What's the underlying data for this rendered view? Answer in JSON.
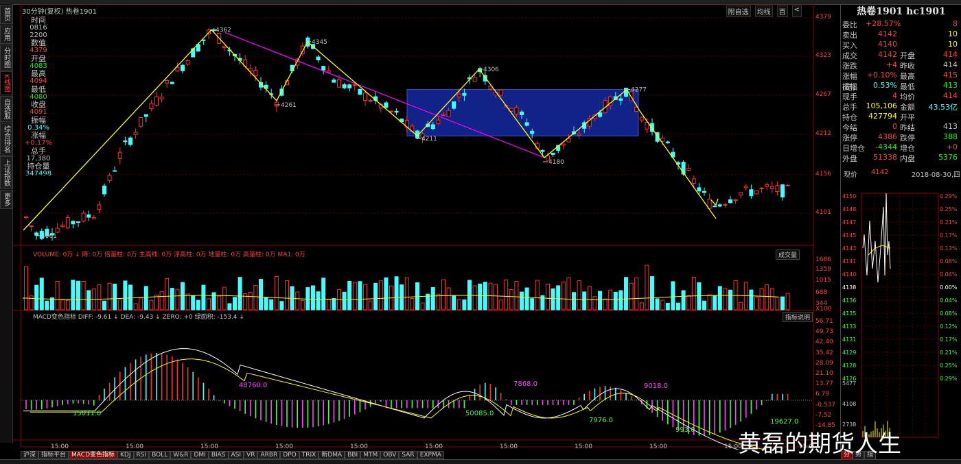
{
  "panel_title": "30分钟(复权)  热卷1901",
  "top_tools": [
    "附自选",
    "均线",
    "百",
    "<"
  ],
  "left_tabs": [
    "首页",
    "应用",
    "分时图",
    "K线图",
    "自选股",
    "综合排名",
    "上证指数",
    "更多"
  ],
  "info": [
    {
      "label": "时间",
      "value": "0816"
    },
    {
      "label": "",
      "value": "2200"
    },
    {
      "label": "数值",
      "value": "4379"
    },
    {
      "label": "开盘",
      "value": "4083"
    },
    {
      "label": "最高",
      "value": "4094"
    },
    {
      "label": "最低",
      "value": "4080"
    },
    {
      "label": "收盘",
      "value": "4091"
    },
    {
      "label": "振幅",
      "value": "0.34%"
    },
    {
      "label": "涨幅",
      "value": "+0.17%"
    },
    {
      "label": "总手",
      "value": "17,380"
    },
    {
      "label": "持仓量",
      "value": "347498"
    }
  ],
  "price_axis": [
    "4379",
    "4323",
    "4267",
    "4212",
    "4156",
    "4101"
  ],
  "price_annotations": [
    "4362",
    "4345",
    "4261",
    "4306",
    "4277",
    "4211",
    "4180",
    "4061"
  ],
  "volume_bar_text": "VOLUME: 0万 ↓  降: 0万  倍量柱: 0万  主高线: 0万  浮高柱: 0万  地量柱: 0万  高量柱: 0万  MA1: 0万",
  "volume_tag": "成交量",
  "volume_axis": [
    "1686",
    "1359",
    "1015",
    "688",
    "344",
    "X100"
  ],
  "macd_bar_text": "MACD变色指标  DIFF: -9.61 ↓  DEA: -9.43 ↓  ZERO: +0  绿面积: -153.4 ↓",
  "macd_tag": "指标说明",
  "macd_axis": [
    "56.71",
    "49.73",
    "42.40",
    "35.42",
    "28.09",
    "21.10",
    "13.77",
    "6.79",
    "-0.537",
    "-7.52",
    "-14.85"
  ],
  "macd_annotations": [
    "48760.0",
    "7868.0",
    "9018.0",
    "15011.0",
    "50085.0",
    "7976.0",
    "993.0",
    "19627.0"
  ],
  "time_labels": [
    "15:00",
    "15:00",
    "15:00",
    "15:00",
    "15:00",
    "15:00",
    "15:00",
    "15:00",
    "15:00",
    "15:00",
    "15:00"
  ],
  "bottom_tabs": [
    "沪深",
    "指标平台",
    "MACD变色指标",
    "KDJ",
    "RSI",
    "BOLL",
    "W&R",
    "DMI",
    "BIAS",
    "ASI",
    "VR",
    "ARBR",
    "DPO",
    "TRIX",
    "新DMA",
    "BBI",
    "MTM",
    "OBV",
    "SAR",
    "EXPMA"
  ],
  "right": {
    "title": "热卷1901  hc1901",
    "rows": [
      {
        "k": "委比",
        "v": "+28.57%",
        "c": "#ff4040",
        "k2": "",
        "v2": "8",
        "c2": "#ff4040"
      },
      {
        "k": "卖出",
        "v": "4142",
        "c": "#ff4040",
        "k2": "",
        "v2": "10",
        "c2": "#ffff00"
      },
      {
        "k": "买入",
        "v": "4140",
        "c": "#ff4040",
        "k2": "",
        "v2": "10",
        "c2": "#ffff00"
      },
      {
        "k": "成交",
        "v": "4142",
        "c": "#ff4040",
        "k2": "开盘",
        "v2": "414",
        "c2": "#ff4040"
      },
      {
        "k": "涨跌",
        "v": "+4",
        "c": "#ff4040",
        "k2": "昨收",
        "v2": "414",
        "c2": "#c0c0c0"
      },
      {
        "k": "涨幅(结)",
        "v": "+0.10%",
        "c": "#ff4040",
        "k2": "最高",
        "v2": "415",
        "c2": "#ff4040"
      },
      {
        "k": "振幅",
        "v": "0.53%",
        "c": "#40ffff",
        "k2": "最低",
        "v2": "413",
        "c2": "#00ff00"
      },
      {
        "k": "现手",
        "v": "4",
        "c": "#ff4040",
        "k2": "均价",
        "v2": "414",
        "c2": "#ff4040"
      },
      {
        "k": "总手",
        "v": "105,106",
        "c": "#ffff00",
        "k2": "金额",
        "v2": "43.53亿",
        "c2": "#40ffff"
      },
      {
        "k": "持仓",
        "v": "427794",
        "c": "#ffff00",
        "k2": "开平",
        "v2": "",
        "c2": "#c0c0c0"
      },
      {
        "k": "今结",
        "v": "0",
        "c": "#ff4040",
        "k2": "昨结",
        "v2": "413",
        "c2": "#c0c0c0"
      },
      {
        "k": "涨停",
        "v": "4386",
        "c": "#ff4040",
        "k2": "跌停",
        "v2": "388",
        "c2": "#00ff00"
      },
      {
        "k": "日增仓",
        "v": "-4344",
        "c": "#00ff00",
        "k2": "增仓",
        "v2": "+0",
        "c2": "#ff4040"
      },
      {
        "k": "外盘",
        "v": "51338",
        "c": "#ff4040",
        "k2": "内盘",
        "v2": "5376",
        "c2": "#00ff00"
      }
    ],
    "now_label": "现价",
    "now_value": "4142",
    "date": "2018-08-30,四",
    "mini_left_axis": [
      "4150",
      "4148",
      "4147",
      "4145",
      "4143",
      "4141",
      "4140",
      "4138",
      "4136",
      "4135",
      "4133",
      "4131",
      "4129",
      "4128",
      "4126",
      "5477",
      "4108",
      "2738"
    ],
    "mini_right_axis": [
      "0.29%",
      "0.25%",
      "0.21%",
      "0.17%",
      "0.13%",
      "0.08%",
      "0.04%",
      "0.00%",
      "0.04%",
      "0.08%",
      "0.12%",
      "0.17%",
      "0.21%",
      "0.25%",
      "0.29%"
    ],
    "bottom_tabs": [
      "分",
      "势",
      "指"
    ]
  },
  "watermark": "黄磊的期货人生",
  "colors": {
    "up": "#ff3030",
    "down": "#40ffff",
    "yellow": "#ffff00",
    "magenta": "#ff00ff",
    "box": "#1428a0"
  }
}
